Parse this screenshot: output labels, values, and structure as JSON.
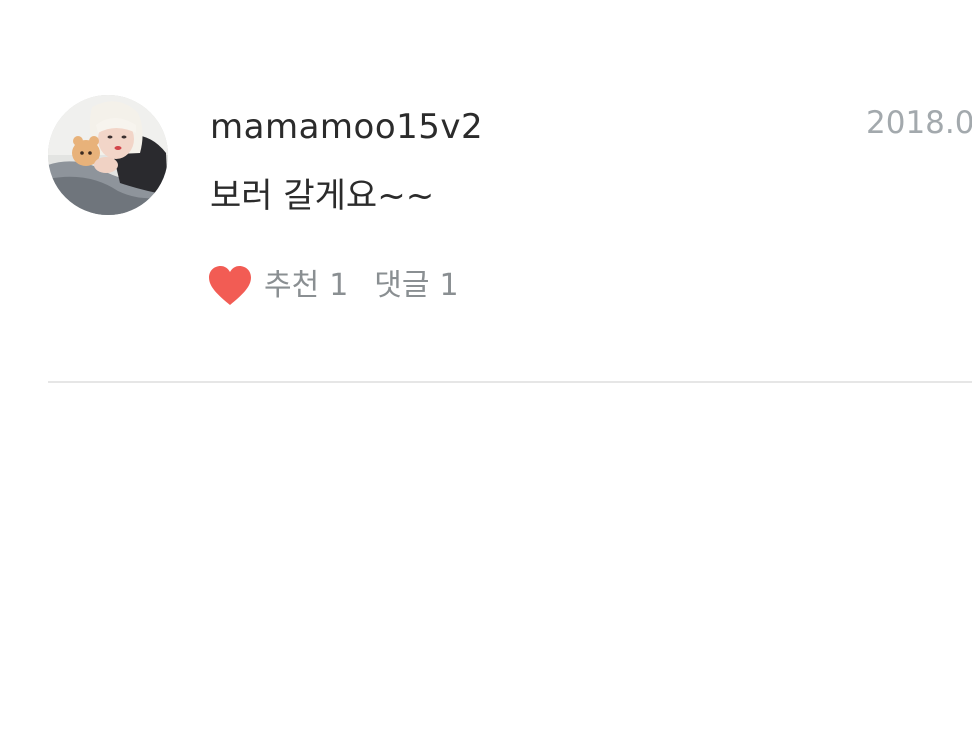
{
  "comment": {
    "username": "mamamoo15v2",
    "timestamp": "2018.0",
    "body": "보러 갈게요~~",
    "avatar_description": "profile-photo",
    "actions": {
      "like_icon": "heart-icon",
      "like_label": "추천",
      "like_count": "1",
      "reply_label": "댓글",
      "reply_count": "1"
    }
  },
  "colors": {
    "heart": "#f25c54",
    "username": "#2b2b2b",
    "timestamp": "#a3a9ad",
    "action_text": "#8a8f92",
    "divider": "#e6e6e6"
  }
}
